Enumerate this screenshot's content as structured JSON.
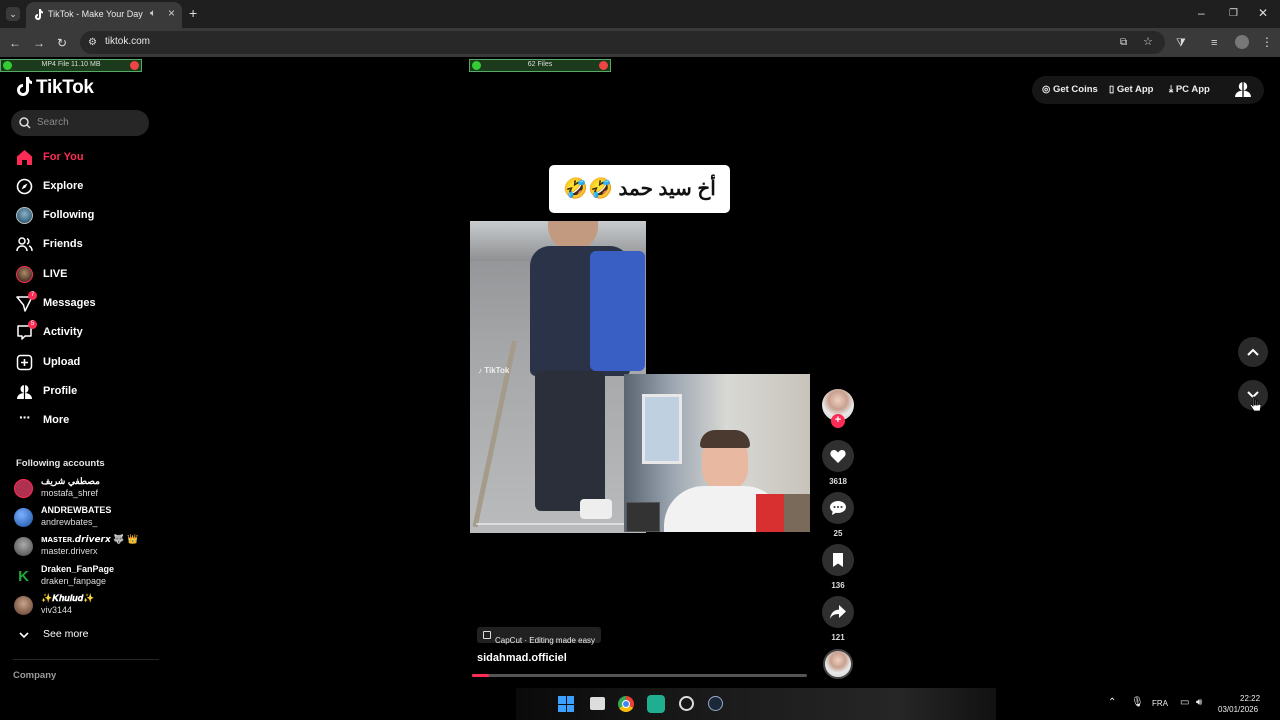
{
  "browser": {
    "tab_title": "TikTok - Make Your Day",
    "url": "tiktok.com"
  },
  "downloads": [
    {
      "label": "MP4 File 11.10 MB"
    },
    {
      "label": "62 Files"
    }
  ],
  "sidebar": {
    "logo": "TikTok",
    "search_placeholder": "Search",
    "nav": [
      {
        "label": "For You",
        "icon": "home-icon",
        "active": true
      },
      {
        "label": "Explore",
        "icon": "compass-icon"
      },
      {
        "label": "Following",
        "icon": "following-avatar-icon"
      },
      {
        "label": "Friends",
        "icon": "friends-icon"
      },
      {
        "label": "LIVE",
        "icon": "live-avatar-icon"
      },
      {
        "label": "Messages",
        "icon": "send-icon",
        "badge": "7"
      },
      {
        "label": "Activity",
        "icon": "activity-icon",
        "badge": "5"
      },
      {
        "label": "Upload",
        "icon": "plus-square-icon"
      },
      {
        "label": "Profile",
        "icon": "profile-icon"
      },
      {
        "label": "More",
        "icon": "ellipsis-icon"
      }
    ],
    "following_title": "Following accounts",
    "accounts": [
      {
        "name": "مصطفي شريف",
        "username": "mostafa_shref",
        "avatar_color": "#b03050"
      },
      {
        "name": "ANDREWBATES",
        "username": "andrewbates_",
        "avatar_color": "#2a6fc4"
      },
      {
        "name": "ᴍᴀsᴛᴇʀ.𝙙𝙧𝙞𝙫𝙚𝙧𝙭 🐺 👑",
        "username": "master.driverx",
        "avatar_color": "#666666"
      },
      {
        "name": "Draken_FanPage",
        "username": "draken_fanpage",
        "avatar_color": "#1faa3a"
      },
      {
        "name": "✨𝑲𝒉𝒖𝒍𝒖𝒅✨",
        "username": "viv3144",
        "avatar_color": "#8a5a4a"
      }
    ],
    "see_more": "See more",
    "company": "Company"
  },
  "topbar": {
    "get_coins": "Get Coins",
    "get_app": "Get App",
    "pc_app": "PC App"
  },
  "video": {
    "caption_text": "أخ سيد حمد 🤣🤣",
    "watermark": "TikTok",
    "capcut_label": "CapCut · Editing made easy",
    "author": "sidahmad.officiel",
    "progress": 0.05
  },
  "actions": {
    "likes": "3618",
    "comments": "25",
    "saves": "136",
    "shares": "121"
  },
  "taskbar": {
    "language": "FRA",
    "time": "22:22",
    "date": "03/01/2026"
  },
  "colors": {
    "accent": "#fe2c55",
    "background": "#000000"
  }
}
